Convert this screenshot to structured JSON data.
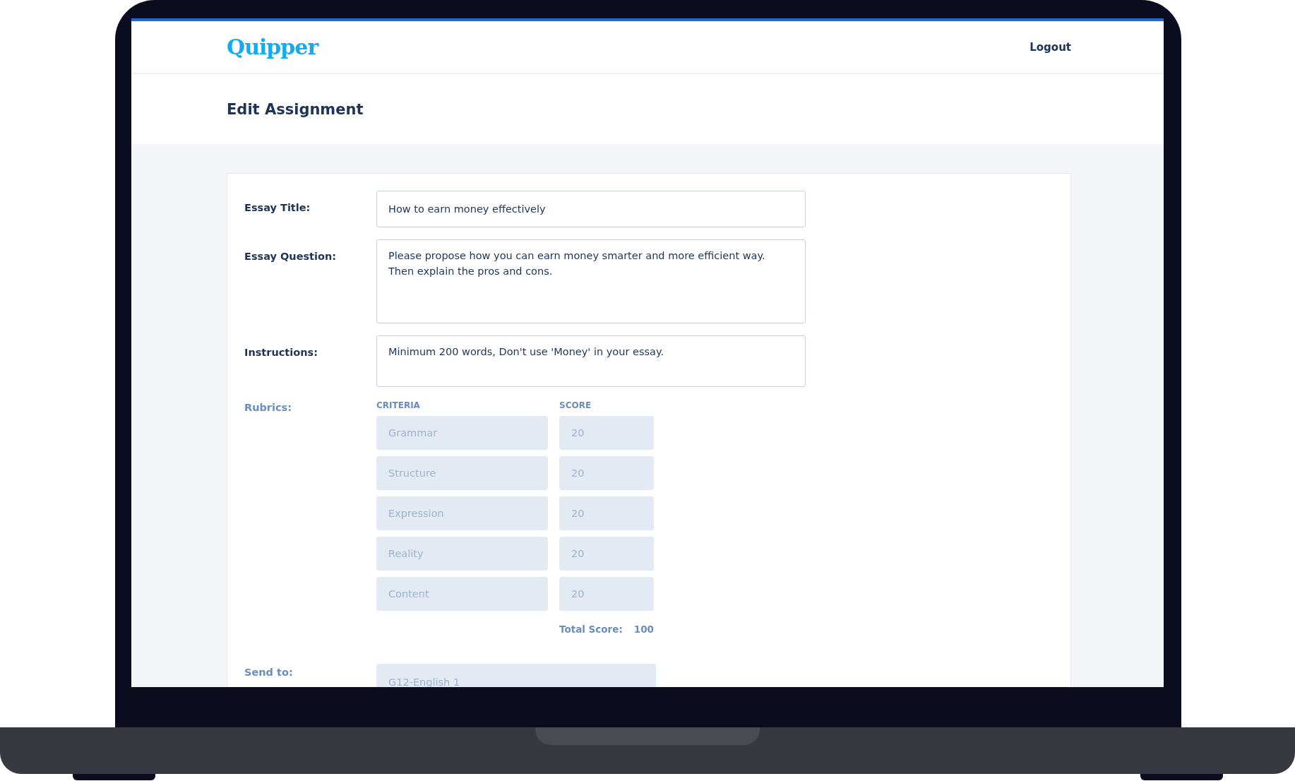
{
  "header": {
    "logo": "Quipper",
    "logout": "Logout"
  },
  "page_title": "Edit Assignment",
  "fields": [
    {
      "label": "Essay Title:",
      "kind": "input",
      "value": "How to earn money effectively",
      "disabled": false
    },
    {
      "label": "Essay Question:",
      "kind": "textarea",
      "value": "Please propose how you can earn money smarter and more efficient way. Then explain the pros and cons.",
      "disabled": false
    },
    {
      "label": "Instructions:",
      "kind": "short-textarea",
      "value": "Minimum 200 words, Don't use 'Money' in your essay.",
      "disabled": false
    }
  ],
  "rubrics": {
    "label": "Rubrics:",
    "disabled": true,
    "criteria_header": "CRITERIA",
    "score_header": "SCORE",
    "rows": [
      {
        "criteria": "Grammar",
        "score": "20"
      },
      {
        "criteria": "Structure",
        "score": "20"
      },
      {
        "criteria": "Expression",
        "score": "20"
      },
      {
        "criteria": "Reality",
        "score": "20"
      },
      {
        "criteria": "Content",
        "score": "20"
      }
    ],
    "total_label": "Total Score:",
    "total": "100"
  },
  "send_to": {
    "label": "Send to:",
    "value": "G12-English 1",
    "disabled": true
  }
}
